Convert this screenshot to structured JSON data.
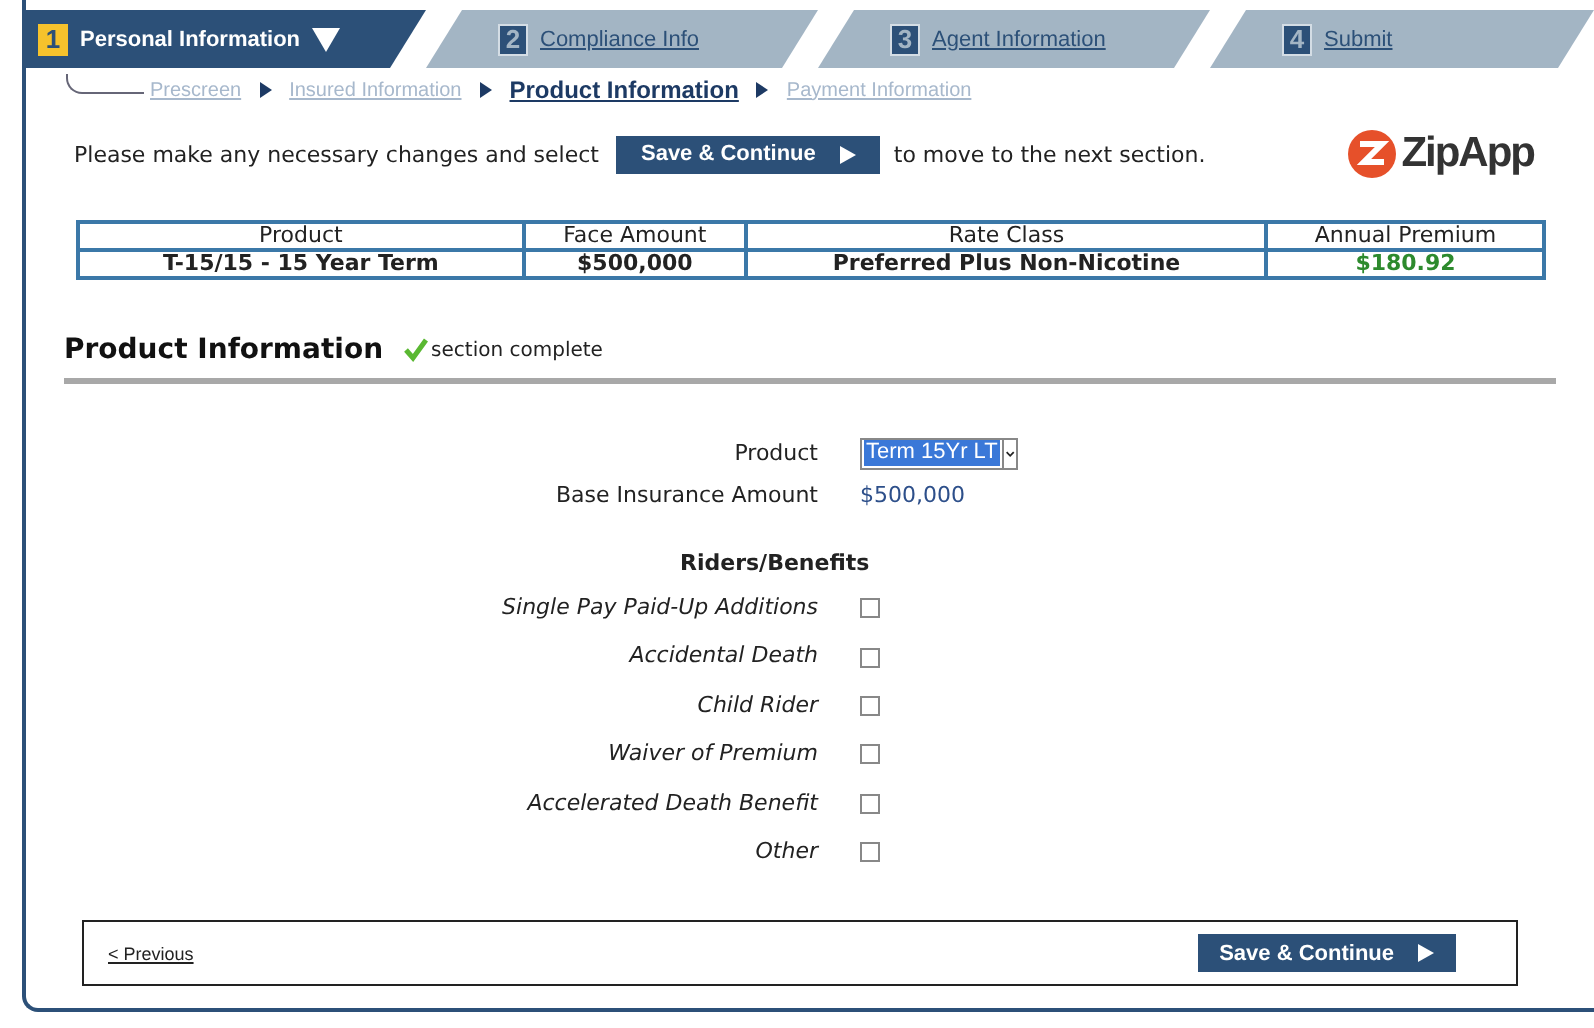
{
  "tabs": [
    {
      "number": "1",
      "label": "Personal Information",
      "selected": true
    },
    {
      "number": "2",
      "label": "Compliance Info",
      "selected": false
    },
    {
      "number": "3",
      "label": "Agent Information",
      "selected": false
    },
    {
      "number": "4",
      "label": "Submit",
      "selected": false
    }
  ],
  "breadcrumb": [
    {
      "label": "Prescreen",
      "selected": false
    },
    {
      "label": "Insured Information",
      "selected": false
    },
    {
      "label": "Product Information",
      "selected": true
    },
    {
      "label": "Payment Information",
      "selected": false
    }
  ],
  "intro": {
    "before": "Please make any necessary changes and select",
    "button": "Save & Continue",
    "after": "to move to the next section.",
    "logo": "ZipApp"
  },
  "summary": {
    "columns": [
      "Product",
      "Face Amount",
      "Rate Class",
      "Annual Premium"
    ],
    "row": [
      "T-15/15 - 15 Year Term",
      "$500,000",
      "Preferred Plus Non-Nicotine",
      "$180.92"
    ]
  },
  "section": {
    "title": "Product Information",
    "status": "section complete"
  },
  "form": {
    "product_label": "Product",
    "product_value": "Term 15Yr LT",
    "base_label": "Base Insurance Amount",
    "base_value": "$500,000",
    "riders_title": "Riders/Benefits",
    "riders": [
      {
        "label": "Single Pay Paid-Up Additions",
        "checked": false
      },
      {
        "label": "Accidental Death",
        "checked": false
      },
      {
        "label": "Child Rider",
        "checked": false
      },
      {
        "label": "Waiver of Premium",
        "checked": false
      },
      {
        "label": "Accelerated Death Benefit",
        "checked": false
      },
      {
        "label": "Other",
        "checked": false
      }
    ]
  },
  "footer": {
    "previous": "< Previous",
    "button": "Save & Continue"
  }
}
